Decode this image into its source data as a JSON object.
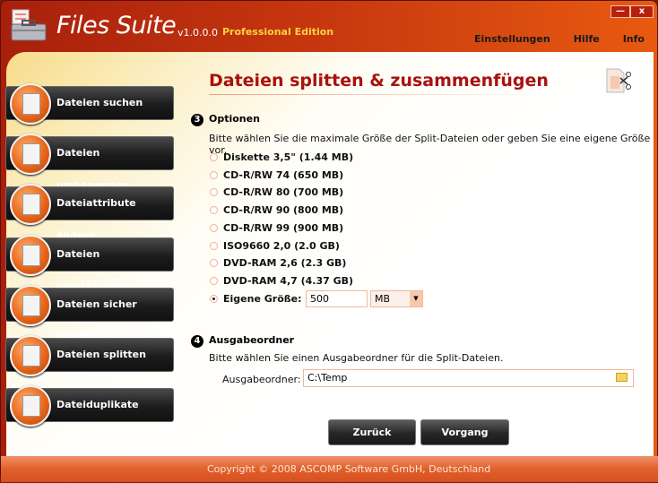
{
  "app": {
    "name": "Files Suite",
    "version": "v1.0.0.0",
    "edition": "Professional Edition"
  },
  "window": {
    "minimize": "—",
    "close": "x"
  },
  "menu": [
    "Einstellungen",
    "Hilfe",
    "Info"
  ],
  "sidebar": [
    {
      "label": "Dateien suchen",
      "icon": "magnifier-icon"
    },
    {
      "label": "Dateien umbenennen",
      "icon": "rename-ab-icon"
    },
    {
      "label": "Dateiattribute ändern",
      "icon": "clock-document-icon"
    },
    {
      "label": "Dateien verschlüsseln",
      "icon": "lock-icon"
    },
    {
      "label": "Dateien sicher löschen",
      "icon": "shredder-icon"
    },
    {
      "label": "Dateien splitten",
      "icon": "scissors-icon",
      "active": true
    },
    {
      "label": "Dateiduplikate finden",
      "icon": "duplicate-icon"
    }
  ],
  "main": {
    "title": "Dateien splitten & zusammenfügen",
    "options": {
      "number": "3",
      "heading": "Optionen",
      "description": "Bitte wählen Sie die maximale Größe der Split-Dateien oder geben Sie eine eigene Größe vor.",
      "choices": [
        "Diskette 3,5\" (1.44 MB)",
        "CD-R/RW 74 (650 MB)",
        "CD-R/RW 80 (700 MB)",
        "CD-R/RW 90 (800 MB)",
        "CD-R/RW 99 (900 MB)",
        "ISO9660 2,0 (2.0 GB)",
        "DVD-RAM 2,6 (2.3 GB)",
        "DVD-RAM 4,7 (4.37 GB)"
      ],
      "custom_label": "Eigene Größe:",
      "custom_value": "500",
      "unit": "MB",
      "selected": "custom"
    },
    "output": {
      "number": "4",
      "heading": "Ausgabeordner",
      "description": "Bitte wählen Sie einen Ausgabeordner für die Split-Dateien.",
      "label": "Ausgabeordner:",
      "value": "C:\\Temp"
    },
    "buttons": {
      "back": "Zurück",
      "start": "Vorgang starten"
    }
  },
  "footer": "Copyright © 2008 ASCOMP Software GmbH, Deutschland",
  "colors": {
    "accent": "#a8120e",
    "orange": "#e8661a"
  }
}
